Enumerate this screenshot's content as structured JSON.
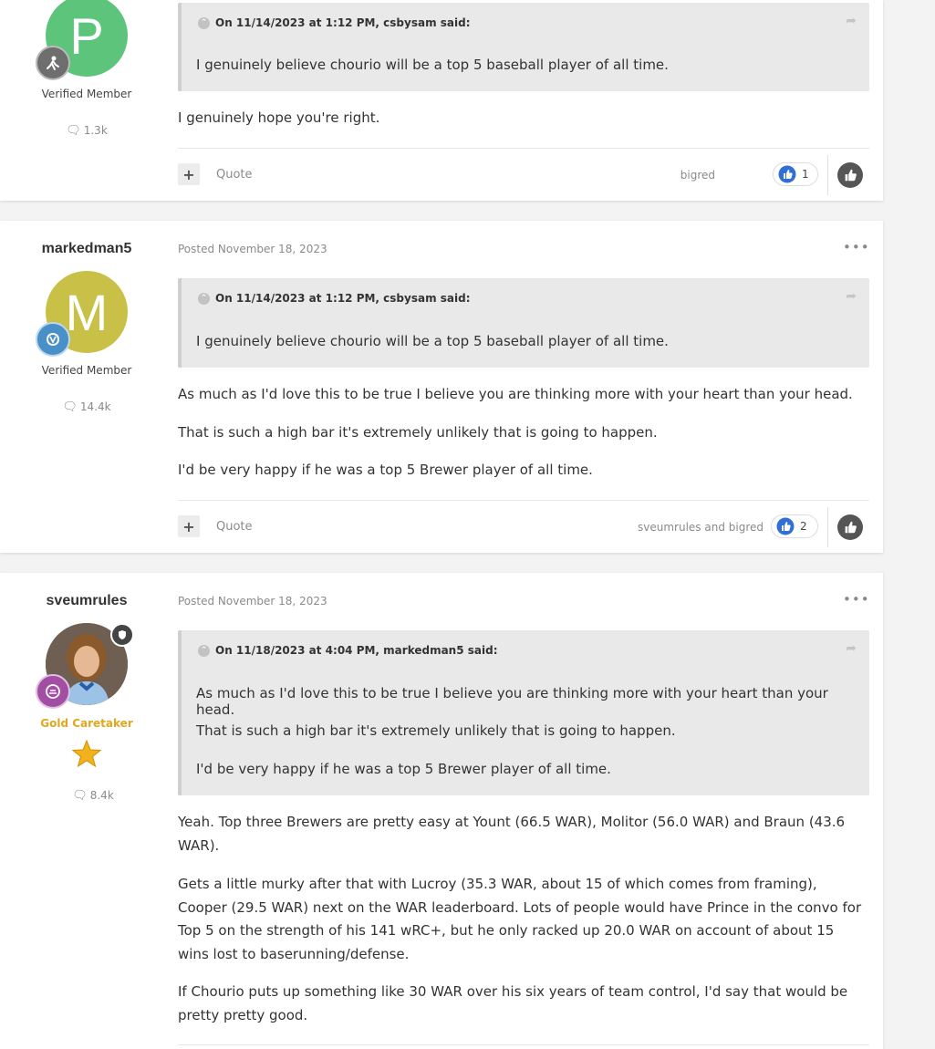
{
  "posts": [
    {
      "author_initial": "P",
      "member_title": "Verified Member",
      "post_count": "1.3k",
      "quote": {
        "header": "On 11/14/2023 at 1:12 PM, csbysam said:",
        "lines": [
          "I genuinely believe chourio will be a top 5 baseball player of all time."
        ]
      },
      "body": [
        "I genuinely hope you're right."
      ],
      "footer": {
        "quote_label": "Quote",
        "reacted_by": "bigred",
        "reaction_count": "1"
      }
    },
    {
      "author": "markedman5",
      "author_initial": "M",
      "member_title": "Verified Member",
      "post_count": "14.4k",
      "posted": "Posted November 18, 2023",
      "quote": {
        "header": "On 11/14/2023 at 1:12 PM, csbysam said:",
        "lines": [
          "I genuinely believe chourio will be a top 5 baseball player of all time."
        ]
      },
      "body": [
        "As much as I'd love this to be true I believe you are thinking more with your heart than your head.",
        "That is such a high bar it's extremely unlikely that is going to happen.",
        "I'd be very happy if he was a top 5 Brewer player of all time."
      ],
      "footer": {
        "quote_label": "Quote",
        "reacted_by": "sveumrules and bigred",
        "reaction_count": "2"
      }
    },
    {
      "author": "sveumrules",
      "member_title": "Gold Caretaker",
      "post_count": "8.4k",
      "posted": "Posted November 18, 2023",
      "quote": {
        "header": "On 11/18/2023 at 4:04 PM, markedman5 said:",
        "lines": [
          "As much as I'd love this to be true I believe you are thinking more with your heart than your head.",
          "That is such a high bar it's extremely unlikely that is going to happen.",
          "I'd be very happy if he was a top 5 Brewer player of all time."
        ]
      },
      "body": [
        "Yeah. Top three Brewers are pretty easy at Yount (66.5 WAR), Molitor (56.0 WAR) and Braun (43.6 WAR).",
        "Gets a little murky after that with Lucroy (35.3 WAR, about 15 of which comes from framing), Cooper (29.5 WAR) next on the WAR leaderboard. Lots of people would have Prince in the convo for Top 5 on the strength of his 141 wRC+, but he only racked up 20.0 WAR on account of about 15 wins lost to baserunning/defense.",
        "If Chourio puts up something like 30 WAR over his six years of team control, I'd say that would be pretty pretty good."
      ]
    }
  ],
  "icons": {
    "more": "•••",
    "toggle": "⌄",
    "share": "➦",
    "plus": "+",
    "comment_bubble": "💬"
  },
  "colors": {
    "avatar_p": "#5dc57b",
    "avatar_m": "#c9c048",
    "gold_title": "#e0a81f",
    "like_blue": "#2f6fd6"
  }
}
